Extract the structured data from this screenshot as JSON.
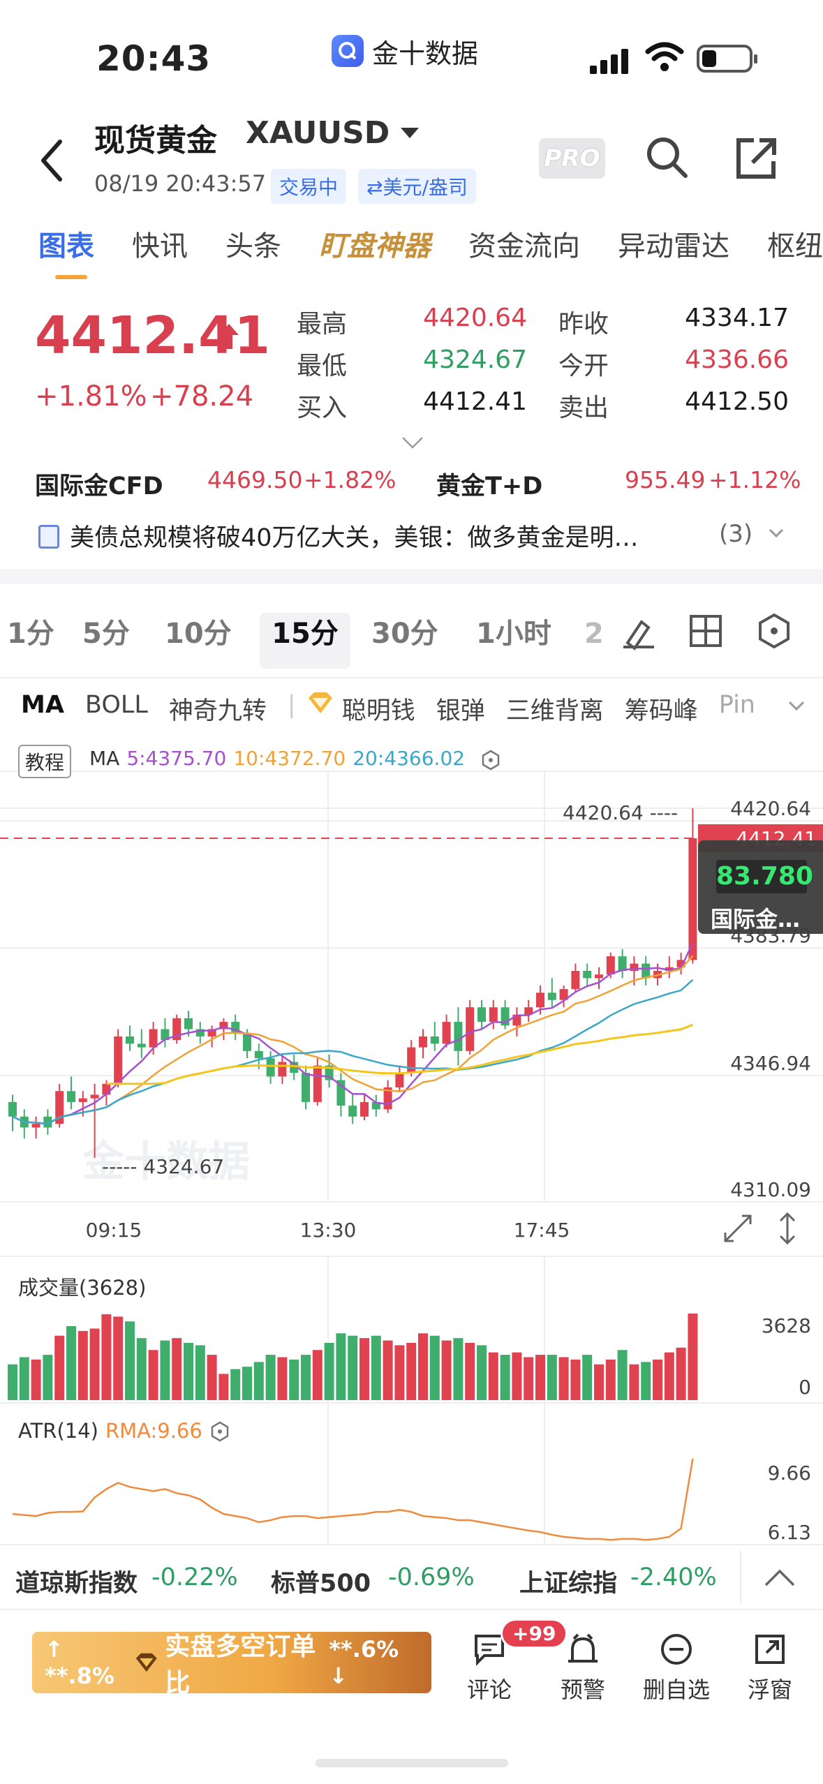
{
  "status_bar": {
    "time": "20:43",
    "app_name": "金十数据"
  },
  "header": {
    "title": "现货黄金",
    "code": "XAUUSD",
    "timestamp": "08/19 20:43:57",
    "trading_badge": "交易中",
    "currency_badge": "⇄美元/盎司",
    "pro_label": "PRO"
  },
  "tabs": [
    "图表",
    "快讯",
    "头条",
    "盯盘神器",
    "资金流向",
    "异动雷达",
    "枢纽"
  ],
  "quote": {
    "price": "4412.41",
    "change_pct": "+1.81%",
    "change_abs": "+78.24",
    "stats": [
      {
        "label": "最高",
        "value": "4420.64",
        "color": "up"
      },
      {
        "label": "昨收",
        "value": "4334.17",
        "color": "dark"
      },
      {
        "label": "最低",
        "value": "4324.67",
        "color": "down"
      },
      {
        "label": "今开",
        "value": "4336.66",
        "color": "up"
      },
      {
        "label": "买入",
        "value": "4412.41",
        "color": "dark"
      },
      {
        "label": "卖出",
        "value": "4412.50",
        "color": "dark"
      }
    ]
  },
  "related": [
    {
      "name": "国际金CFD",
      "value": "4469.50",
      "change": "+1.82%"
    },
    {
      "name": "黄金T+D",
      "value": "955.49",
      "change": "+1.12%"
    }
  ],
  "news": {
    "text": "美债总规模将破40万亿大关，美银：做多黄金是明…",
    "count": "(3)"
  },
  "periods": [
    "1分",
    "5分",
    "10分",
    "15分",
    "30分",
    "1小时",
    "2"
  ],
  "active_period": "15分",
  "indicators": [
    "MA",
    "BOLL",
    "神奇九转",
    "聪明钱",
    "银弹",
    "三维背离",
    "筹码峰",
    "Pin"
  ],
  "chart": {
    "edu_label": "教程",
    "ma_label": "MA",
    "ma5": "5:4375.70",
    "ma10": "10:4372.70",
    "ma20": "20:4366.02",
    "high_marker": "4420.64",
    "low_marker": "4324.67",
    "price_tag": "4412.41",
    "overlay_value": "83.780",
    "overlay_label": "国际金…",
    "overlay_hidden_value": "4383.79",
    "y_ticks": [
      "4420.64",
      "4346.94",
      "4310.09"
    ],
    "x_ticks": [
      "09:15",
      "13:30",
      "17:45"
    ],
    "watermark": "金十数据",
    "colors": {
      "up": "#e0424f",
      "down": "#3fae6c",
      "ma5": "#a64fd0",
      "ma10": "#f0a237",
      "ma20": "#3aa7c9",
      "ma_long": "#f4c51a"
    }
  },
  "volume": {
    "label": "成交量(3628)",
    "max_tick": "3628",
    "min_tick": "0"
  },
  "atr": {
    "label": "ATR(14)",
    "rma": "RMA:9.66",
    "ticks": [
      "9.66",
      "6.13"
    ]
  },
  "chart_data": [
    {
      "type": "candlestick",
      "title": "",
      "interval": "15分",
      "ylim": [
        4310.09,
        4420.64
      ],
      "x_ticks": [
        "09:15",
        "13:30",
        "17:45"
      ],
      "ohlc": [
        [
          4340,
          4342,
          4332,
          4336
        ],
        [
          4336,
          4338,
          4330,
          4333
        ],
        [
          4333,
          4336,
          4330,
          4334
        ],
        [
          4336,
          4338,
          4331,
          4333
        ],
        [
          4334,
          4345,
          4333,
          4343
        ],
        [
          4343,
          4347,
          4338,
          4340
        ],
        [
          4340,
          4343,
          4336,
          4341
        ],
        [
          4341,
          4345,
          4324.67,
          4342
        ],
        [
          4342,
          4346,
          4339,
          4345
        ],
        [
          4345,
          4360,
          4344,
          4358
        ],
        [
          4358,
          4361,
          4354,
          4356
        ],
        [
          4356,
          4360,
          4352,
          4355
        ],
        [
          4355,
          4362,
          4353,
          4360
        ],
        [
          4360,
          4363,
          4355,
          4357
        ],
        [
          4357,
          4364,
          4356,
          4363
        ],
        [
          4363,
          4365,
          4358,
          4360
        ],
        [
          4360,
          4362,
          4356,
          4358
        ],
        [
          4358,
          4361,
          4355,
          4360
        ],
        [
          4360,
          4363,
          4357,
          4362
        ],
        [
          4362,
          4364,
          4357,
          4359
        ],
        [
          4359,
          4360,
          4352,
          4354
        ],
        [
          4354,
          4356,
          4349,
          4352
        ],
        [
          4352,
          4354,
          4345,
          4347
        ],
        [
          4347,
          4353,
          4345,
          4351
        ],
        [
          4351,
          4353,
          4346,
          4348
        ],
        [
          4348,
          4350,
          4338,
          4340
        ],
        [
          4340,
          4352,
          4339,
          4350
        ],
        [
          4350,
          4353,
          4344,
          4346
        ],
        [
          4346,
          4348,
          4336,
          4339
        ],
        [
          4339,
          4342,
          4334,
          4336
        ],
        [
          4336,
          4342,
          4335,
          4340
        ],
        [
          4340,
          4342,
          4336,
          4338
        ],
        [
          4338,
          4346,
          4337,
          4344
        ],
        [
          4344,
          4350,
          4343,
          4348
        ],
        [
          4348,
          4357,
          4347,
          4355
        ],
        [
          4355,
          4360,
          4352,
          4358
        ],
        [
          4358,
          4362,
          4354,
          4356
        ],
        [
          4356,
          4364,
          4355,
          4362
        ],
        [
          4362,
          4366,
          4350,
          4354
        ],
        [
          4354,
          4368,
          4353,
          4366
        ],
        [
          4366,
          4368,
          4360,
          4362
        ],
        [
          4362,
          4368,
          4360,
          4366
        ],
        [
          4366,
          4368,
          4360,
          4361
        ],
        [
          4361,
          4366,
          4358,
          4364
        ],
        [
          4364,
          4368,
          4362,
          4366
        ],
        [
          4366,
          4372,
          4364,
          4370
        ],
        [
          4370,
          4374,
          4366,
          4368
        ],
        [
          4368,
          4372,
          4366,
          4371
        ],
        [
          4371,
          4378,
          4370,
          4376
        ],
        [
          4376,
          4378,
          4372,
          4374
        ],
        [
          4374,
          4377,
          4371,
          4375
        ],
        [
          4375,
          4381,
          4374,
          4380
        ],
        [
          4380,
          4382,
          4374,
          4376
        ],
        [
          4376,
          4380,
          4372,
          4378
        ],
        [
          4378,
          4380,
          4372,
          4374
        ],
        [
          4374,
          4378,
          4372,
          4376
        ],
        [
          4376,
          4380,
          4374,
          4377
        ],
        [
          4377,
          4381,
          4375,
          4379
        ],
        [
          4379,
          4420.64,
          4378,
          4412.41
        ]
      ]
    },
    {
      "type": "bar",
      "title": "成交量(3628)",
      "ylim": [
        0,
        3628
      ],
      "values": [
        1500,
        1800,
        1700,
        1900,
        2700,
        3100,
        2900,
        3000,
        3600,
        3500,
        3300,
        2600,
        2100,
        2500,
        2600,
        2400,
        2300,
        1900,
        1100,
        1300,
        1400,
        1600,
        1900,
        1800,
        1700,
        1900,
        2100,
        2400,
        2800,
        2700,
        2600,
        2700,
        2500,
        2300,
        2400,
        2800,
        2700,
        2500,
        2600,
        2400,
        2300,
        2000,
        1900,
        2000,
        1800,
        1900,
        1900,
        1800,
        1700,
        1900,
        1500,
        1700,
        2100,
        1500,
        1600,
        1700,
        2000,
        2200,
        3628
      ]
    },
    {
      "type": "line",
      "title": "ATR(14)",
      "ylim": [
        6.13,
        9.66
      ],
      "series": [
        {
          "name": "RMA:9.66",
          "values": [
            7.0,
            6.95,
            6.9,
            7.05,
            7.1,
            7.1,
            7.12,
            7.8,
            8.2,
            8.5,
            8.3,
            8.2,
            8.1,
            8.2,
            8.0,
            7.9,
            7.7,
            7.3,
            7.0,
            6.9,
            6.8,
            6.6,
            6.7,
            6.85,
            6.9,
            6.9,
            6.8,
            6.85,
            6.9,
            6.95,
            7.0,
            7.1,
            7.1,
            7.2,
            7.1,
            6.9,
            6.85,
            6.8,
            6.7,
            6.7,
            6.6,
            6.5,
            6.4,
            6.3,
            6.2,
            6.13,
            6.0,
            5.9,
            5.85,
            5.8,
            5.8,
            5.75,
            5.8,
            5.8,
            5.75,
            5.8,
            5.9,
            6.3,
            9.66
          ]
        }
      ]
    }
  ],
  "bottom_indices": [
    {
      "name": "道琼斯指数",
      "change": "-0.22%"
    },
    {
      "name": "标普500",
      "change": "-0.69%"
    },
    {
      "name": "上证综指",
      "change": "-2.40%"
    }
  ],
  "toolbar": {
    "ratio_left": "**.8%",
    "ratio_center": "实盘多空订单比",
    "ratio_right": "**.6%",
    "badge": "+99",
    "items": [
      "评论",
      "预警",
      "删自选",
      "浮窗"
    ]
  }
}
